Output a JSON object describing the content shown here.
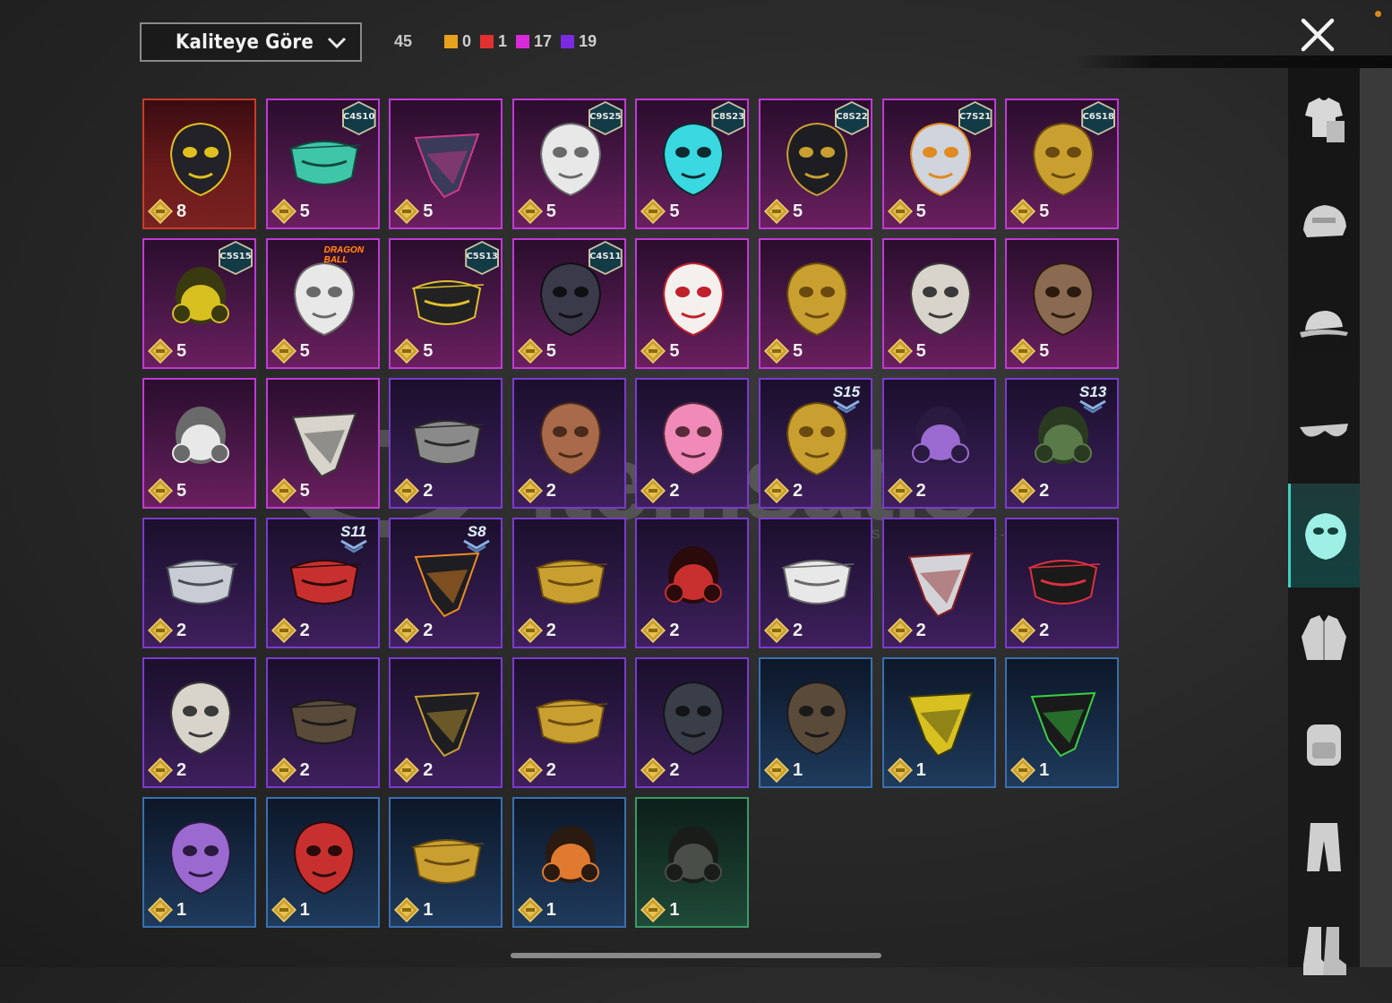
{
  "toolbar": {
    "sort_label": "Kaliteye Göre",
    "total_count": "45",
    "quality_counts": [
      {
        "color": "#e8a11a",
        "count": "0"
      },
      {
        "color": "#e03030",
        "count": "1"
      },
      {
        "color": "#d82ad8",
        "count": "17"
      },
      {
        "color": "#7a2ae0",
        "count": "19"
      }
    ]
  },
  "watermark": {
    "brand": "itemsatis",
    "tagline": "HESAP / SKIN / ITEM / E-PIN",
    "suffix": ".com"
  },
  "items": [
    {
      "rarity": "legendary",
      "qty": "8",
      "art": "spider-helmet-mask",
      "badge": null
    },
    {
      "rarity": "mythic",
      "qty": "5",
      "art": "teal-half-mask",
      "badge": {
        "type": "season",
        "text": "C4S10"
      }
    },
    {
      "rarity": "mythic",
      "qty": "5",
      "art": "glitch-bandana",
      "badge": null
    },
    {
      "rarity": "mythic",
      "qty": "5",
      "art": "white-spiked-mask",
      "badge": {
        "type": "season",
        "text": "C9S25"
      }
    },
    {
      "rarity": "mythic",
      "qty": "5",
      "art": "neon-cyan-mask",
      "badge": {
        "type": "season",
        "text": "C8S23"
      }
    },
    {
      "rarity": "mythic",
      "qty": "5",
      "art": "black-ring-mask",
      "badge": {
        "type": "season",
        "text": "C8S22"
      }
    },
    {
      "rarity": "mythic",
      "qty": "5",
      "art": "mecha-jaw-mask",
      "badge": {
        "type": "season",
        "text": "C7S21"
      }
    },
    {
      "rarity": "mythic",
      "qty": "5",
      "art": "gold-horn-mask",
      "badge": {
        "type": "season",
        "text": "C6S18"
      }
    },
    {
      "rarity": "mythic",
      "qty": "5",
      "art": "yellow-respirator",
      "badge": {
        "type": "season",
        "text": "C5S15"
      }
    },
    {
      "rarity": "mythic",
      "qty": "5",
      "art": "white-hair-mask",
      "badge": {
        "type": "logo",
        "text": "DRAGON BALL"
      }
    },
    {
      "rarity": "mythic",
      "qty": "5",
      "art": "graffiti-mask",
      "badge": {
        "type": "season",
        "text": "C5S13"
      }
    },
    {
      "rarity": "mythic",
      "qty": "5",
      "art": "dark-neon-mask",
      "badge": {
        "type": "season",
        "text": "C4S11"
      }
    },
    {
      "rarity": "mythic",
      "qty": "5",
      "art": "kitsune-mask",
      "badge": null
    },
    {
      "rarity": "mythic",
      "qty": "5",
      "art": "gold-blue-visor",
      "badge": null
    },
    {
      "rarity": "mythic",
      "qty": "5",
      "art": "horned-skull-mask",
      "badge": null
    },
    {
      "rarity": "mythic",
      "qty": "5",
      "art": "plague-doctor-mask",
      "badge": null
    },
    {
      "rarity": "mythic",
      "qty": "5",
      "art": "white-hood-respirator",
      "badge": null
    },
    {
      "rarity": "mythic",
      "qty": "5",
      "art": "skull-bandana",
      "badge": null
    },
    {
      "rarity": "epic",
      "qty": "2",
      "art": "grey-half-mask",
      "badge": null
    },
    {
      "rarity": "epic",
      "qty": "2",
      "art": "mammoth-mask",
      "badge": null
    },
    {
      "rarity": "epic",
      "qty": "2",
      "art": "pink-dino-mask",
      "badge": null
    },
    {
      "rarity": "epic",
      "qty": "2",
      "art": "gold-oni-mask",
      "badge": {
        "type": "rank",
        "text": "S15"
      }
    },
    {
      "rarity": "epic",
      "qty": "2",
      "art": "purple-visor-respirator",
      "badge": null
    },
    {
      "rarity": "epic",
      "qty": "2",
      "art": "goggle-respirator",
      "badge": {
        "type": "rank",
        "text": "S13"
      }
    },
    {
      "rarity": "epic",
      "qty": "2",
      "art": "chrome-half-mask",
      "badge": null
    },
    {
      "rarity": "epic",
      "qty": "2",
      "art": "red-mouth-mask",
      "badge": {
        "type": "rank",
        "text": "S11"
      }
    },
    {
      "rarity": "epic",
      "qty": "2",
      "art": "flame-bandana",
      "badge": {
        "type": "rank",
        "text": "S8"
      }
    },
    {
      "rarity": "epic",
      "qty": "2",
      "art": "studded-gold-mask",
      "badge": null
    },
    {
      "rarity": "epic",
      "qty": "2",
      "art": "gas-mask-red",
      "badge": null
    },
    {
      "rarity": "epic",
      "qty": "2",
      "art": "white-teeth-mask",
      "badge": null
    },
    {
      "rarity": "epic",
      "qty": "2",
      "art": "silver-red-bandana",
      "badge": null
    },
    {
      "rarity": "epic",
      "qty": "2",
      "art": "shark-teeth-mask",
      "badge": null
    },
    {
      "rarity": "epic",
      "qty": "2",
      "art": "dark-skull-mask",
      "badge": null
    },
    {
      "rarity": "epic",
      "qty": "2",
      "art": "leather-muzzle",
      "badge": null
    },
    {
      "rarity": "epic",
      "qty": "2",
      "art": "black-bandana",
      "badge": null
    },
    {
      "rarity": "epic",
      "qty": "2",
      "art": "gold-sequin-mask",
      "badge": null
    },
    {
      "rarity": "epic",
      "qty": "2",
      "art": "tactical-face-shield",
      "badge": null
    },
    {
      "rarity": "rare",
      "qty": "1",
      "art": "stitched-leather-mask",
      "badge": null
    },
    {
      "rarity": "rare",
      "qty": "1",
      "art": "yellow-dot-bandana",
      "badge": null
    },
    {
      "rarity": "rare",
      "qty": "1",
      "art": "web-bandana",
      "badge": null
    },
    {
      "rarity": "rare",
      "qty": "1",
      "art": "purple-theater-mask",
      "badge": null
    },
    {
      "rarity": "rare",
      "qty": "1",
      "art": "red-theater-mask",
      "badge": null
    },
    {
      "rarity": "rare",
      "qty": "1",
      "art": "black-gold-mask",
      "badge": null
    },
    {
      "rarity": "rare",
      "qty": "1",
      "art": "orange-respirator",
      "badge": null
    },
    {
      "rarity": "uncommon",
      "qty": "1",
      "art": "military-gas-mask",
      "badge": null
    }
  ],
  "categories": [
    {
      "name": "outfit",
      "active": false
    },
    {
      "name": "helmet",
      "active": false
    },
    {
      "name": "cap",
      "active": false
    },
    {
      "name": "glasses",
      "active": false
    },
    {
      "name": "mask",
      "active": true
    },
    {
      "name": "jacket",
      "active": false
    },
    {
      "name": "backpack",
      "active": false
    },
    {
      "name": "pants",
      "active": false
    },
    {
      "name": "boots",
      "active": false
    }
  ]
}
